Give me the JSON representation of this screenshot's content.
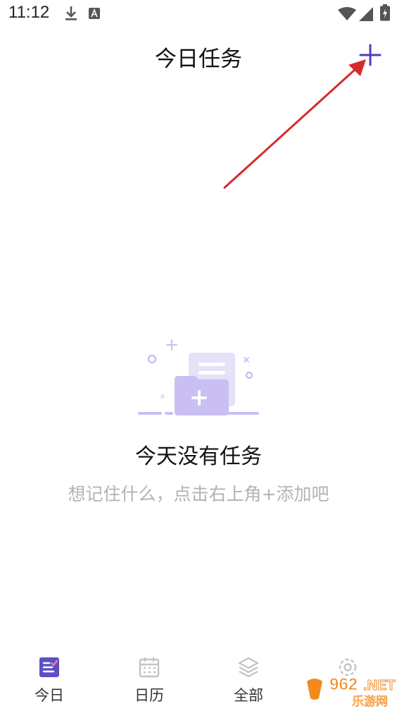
{
  "status_bar": {
    "time": "11:12",
    "icons": [
      "download-icon",
      "a-notification-icon",
      "wifi-icon",
      "signal-icon",
      "battery-charging-icon"
    ]
  },
  "header": {
    "title": "今日任务",
    "add_icon": "plus-icon"
  },
  "empty_state": {
    "illustration": "empty-folder-plus-icon",
    "title": "今天没有任务",
    "hint": "想记住什么，点击右上角+添加吧"
  },
  "bottom_nav": {
    "items": [
      {
        "label": "今日",
        "icon": "today-list-icon",
        "active": true
      },
      {
        "label": "日历",
        "icon": "calendar-icon",
        "active": false
      },
      {
        "label": "全部",
        "icon": "layers-icon",
        "active": false
      },
      {
        "label": "",
        "icon": "gear-icon",
        "active": false
      }
    ]
  },
  "watermark": {
    "brand": "962.NET",
    "subtitle": "乐游网"
  },
  "colors": {
    "accent": "#5b4fc4",
    "accent_light": "#c9bff2",
    "annotation_red": "#d62a2a",
    "hint_gray": "#b3b3b3"
  }
}
